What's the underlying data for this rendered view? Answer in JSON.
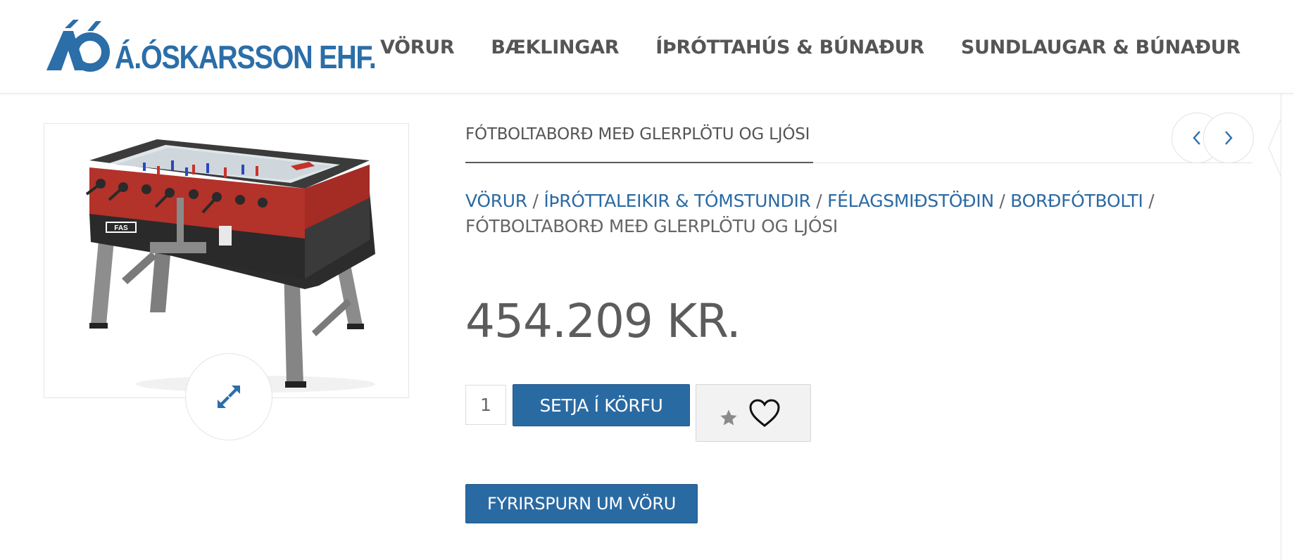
{
  "brand": {
    "logo_text": "Á.ÓSKARSSON EHF.",
    "color": "#2b6ea8"
  },
  "nav": {
    "items": [
      {
        "label": "VÖRUR"
      },
      {
        "label": "BÆKLINGAR"
      },
      {
        "label": "ÍÞRÓTTAHÚS & BÚNAÐUR"
      },
      {
        "label": "SUNDLAUGAR & BÚNAÐUR"
      }
    ]
  },
  "product": {
    "title": "FÓTBOLTABORÐ MEÐ GLERPLÖTU OG LJÓSI",
    "price": "454.209 KR.",
    "quantity": "1",
    "image_icon": "foosball-table-image"
  },
  "breadcrumb": {
    "links": [
      "VÖRUR",
      "ÍÞRÓTTALEIKIR & TÓMSTUNDIR",
      "FÉLAGSMIÐSTÖÐIN",
      "BORÐFÓTBOLTI"
    ],
    "separator": "/",
    "current": "FÓTBOLTABORÐ MEÐ GLERPLÖTU OG LJÓSI"
  },
  "buttons": {
    "add_to_cart": "SETJA Í KÖRFU",
    "inquiry": "FYRIRSPURN UM VÖRU"
  },
  "colors": {
    "primary_button": "#2a6aa2",
    "link": "#2b6aa3",
    "text": "#5e5e5e"
  }
}
